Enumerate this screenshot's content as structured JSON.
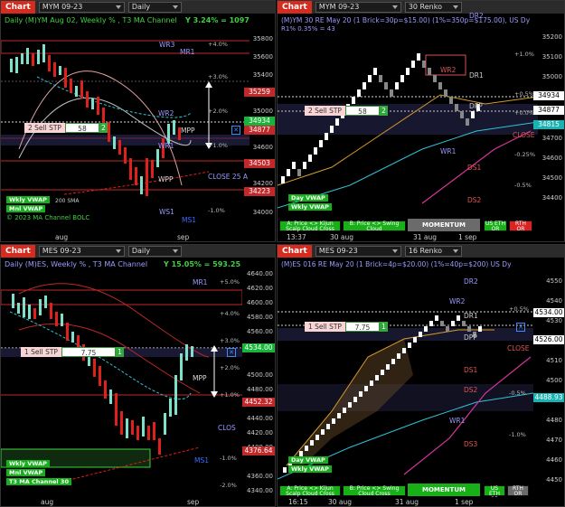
{
  "panels": [
    {
      "chart_btn": "Chart",
      "instrument": "MYM 09-23",
      "period": "Daily",
      "title": "Daily (M)YM  Aug 02, Weekly % , T3 MA Channel",
      "stat": "Y 3.24% = 1097",
      "yticks": [
        "35800",
        "35600",
        "35400",
        "35200",
        "35000",
        "34800",
        "34600",
        "34400",
        "34200",
        "34000"
      ],
      "price_boxes": [
        {
          "value": "35259",
          "color": "#c0282a"
        },
        {
          "value": "34934",
          "color": "#18b33a"
        },
        {
          "value": "34877",
          "color": "#c0282a"
        },
        {
          "value": "34503",
          "color": "#c0282a"
        },
        {
          "value": "34223",
          "color": "#c0282a"
        }
      ],
      "levels": [
        "MR1",
        "WR3",
        "WR2",
        "WR1",
        "MPP",
        "WPP",
        "WS1",
        "MS1",
        "CLOSE 25 A"
      ],
      "pcts": [
        "+4.0%",
        "+3.0%",
        "+2.0%",
        "+1.0%",
        "-1.0%"
      ],
      "order": {
        "label": "2 Sell STP",
        "qty": "58",
        "num": "2"
      },
      "badges": [
        "Wkly VWAP",
        "Mnl VWAP"
      ],
      "sma_label": "200 SMA",
      "watermark": "© 2023 MA Channel BOLC",
      "xlabels": [
        "aug",
        "sep"
      ]
    },
    {
      "chart_btn": "Chart",
      "instrument": "MYM 09-23",
      "period": "30 Renko",
      "title": "(M)YM 30 RE May 20 (1 Brick=30p=$15.00) (1%=350p=$175.00), US Dy",
      "subtitle": "R1% 0.35% = 43",
      "yticks": [
        "35200",
        "35100",
        "35000",
        "34900",
        "34800",
        "34700",
        "34600",
        "34500",
        "34400"
      ],
      "price_boxes": [
        {
          "value": "34934",
          "color": "#ffffff"
        },
        {
          "value": "34877",
          "color": "#ffffff"
        },
        {
          "value": "34815",
          "color": "#18b3b3"
        }
      ],
      "levels": [
        "DR2",
        "WR2",
        "DR1",
        "DPP",
        "WR1",
        "DS1",
        "DS2",
        "CLOSE"
      ],
      "pcts": [
        "+1.0%",
        "+0.5%",
        "+0.0%",
        "-0.25%",
        "-0.5%"
      ],
      "order": {
        "label": "2 Sell STP",
        "qty": "58",
        "num": "2"
      },
      "badges": [
        "Day VWAP",
        "Wkly VWAP"
      ],
      "buttons": {
        "a": "A: Price <> Kijun\nScalp Cloud Cross",
        "b": "B: Price <> Swing\nCloud",
        "momentum": "MOMENTUM",
        "us_etf": "US ETH\nOR",
        "rth": "RTH\nOR"
      },
      "xlabels": [
        "13:37",
        "30 aug",
        "31 aug",
        "1 sep"
      ]
    },
    {
      "chart_btn": "Chart",
      "instrument": "MES 09-23",
      "period": "Daily",
      "title": "Daily (M)ES, Weekly % , T3 MA Channel",
      "stat": "Y 15.05% = 593.25",
      "yticks": [
        "4640.00",
        "4620.00",
        "4600.00",
        "4580.00",
        "4560.00",
        "4540.00",
        "4520.00",
        "4500.00",
        "4480.00",
        "4460.00",
        "4440.00",
        "4420.00",
        "4400.00",
        "4380.00",
        "4360.00",
        "4340.00"
      ],
      "price_boxes": [
        {
          "value": "4534.00",
          "color": "#18b33a"
        },
        {
          "value": "4452.32",
          "color": "#c0282a"
        },
        {
          "value": "4376.64",
          "color": "#c0282a"
        }
      ],
      "levels": [
        "MR1",
        "MPP",
        "CLOS",
        "MS1"
      ],
      "pcts": [
        "+5.0%",
        "+4.0%",
        "+3.0%",
        "+2.0%",
        "+1.0%",
        "-1.0%",
        "-2.0%"
      ],
      "order": {
        "label": "1 Sell STP",
        "qty": "7.75",
        "num": "1"
      },
      "badges": [
        "Wkly VWAP",
        "Mnl VWAP",
        "T3 MA Channel 30"
      ],
      "xlabels": [
        "aug",
        "sep"
      ]
    },
    {
      "chart_btn": "Chart",
      "instrument": "MES 09-23",
      "period": "16 Renko",
      "title": "(M)ES 016 RE May 20 (1 Brick=4p=$20.00) (1%=40p=$200) US Dy",
      "yticks": [
        "4550",
        "4540",
        "4530",
        "4520",
        "4510",
        "4500",
        "4490",
        "4480",
        "4470",
        "4460",
        "4450"
      ],
      "price_boxes": [
        {
          "value": "4534.00",
          "color": "#ffffff"
        },
        {
          "value": "4526.00",
          "color": "#ffffff"
        },
        {
          "value": "4488.93",
          "color": "#18b3b3"
        }
      ],
      "levels": [
        "DR2",
        "WR2",
        "DR1",
        "DPP",
        "DS1",
        "DS2",
        "WR1",
        "DS3",
        "CLOSE"
      ],
      "pcts": [
        "+1.0%",
        "+0.5%",
        "-0.5%",
        "-1.0%"
      ],
      "order": {
        "label": "1 Sell STP",
        "qty": "7.75",
        "num": "1"
      },
      "badges": [
        "Day VWAP",
        "Wkly VWAP"
      ],
      "buttons": {
        "a": "A: Price <> Kijun\nScalp Cloud Cross",
        "b": "B: Price <> Swing\nCloud Cross",
        "momentum": "MOMENTUM",
        "us_etf": "US ETH\nOR",
        "rth": "RTH\nOR"
      },
      "xlabels": [
        "16:15",
        "30 aug",
        "31 aug",
        "1 sep"
      ]
    }
  ],
  "colors": {
    "up": "#7ee0c8",
    "down": "#e0201b",
    "renko_up": "#ffffff",
    "renko_down": "#8a8a8a",
    "vwap": "#2fc2d6",
    "channel": "#d99b2a",
    "pivot": "#9a9aff"
  }
}
